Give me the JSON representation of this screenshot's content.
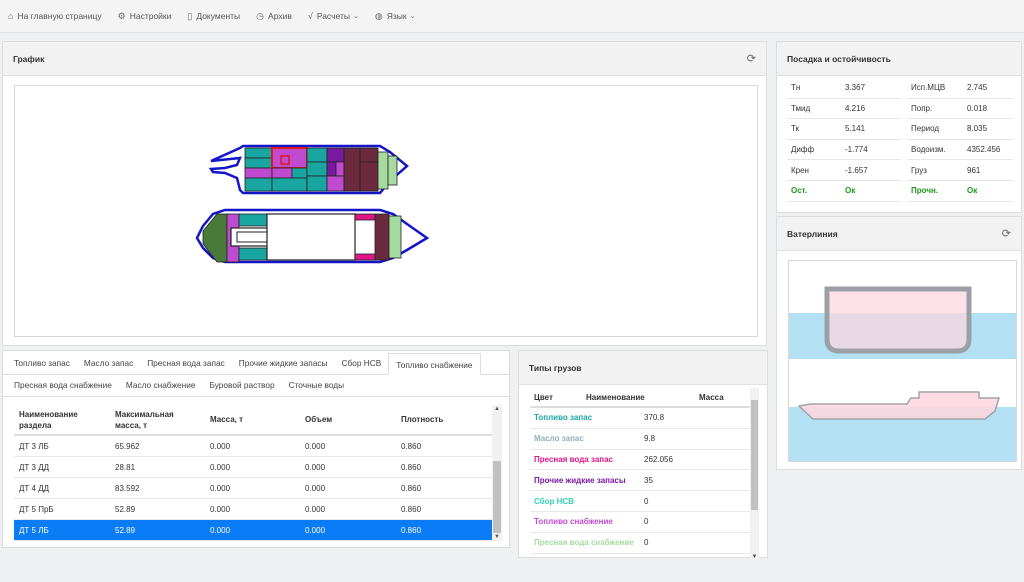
{
  "nav": {
    "home": "На главную страницу",
    "settings": "Настройки",
    "documents": "Документы",
    "archive": "Архив",
    "calculations": "Расчеты",
    "language": "Язык"
  },
  "graph": {
    "title": "График"
  },
  "tabs": {
    "row1": [
      "Топливо запас",
      "Масло запас",
      "Пресная вода запас",
      "Прочие жидкие запасы",
      "Сбор НСВ",
      "Топливо снабжение"
    ],
    "row2": [
      "Пресная вода снабжение",
      "Масло снабжение",
      "Буровой раствор",
      "Сточные воды"
    ],
    "active": "Топливо снабжение"
  },
  "capacity_table": {
    "headers": [
      "Наименование раздела",
      "Максимальная масса, т",
      "Масса, т",
      "Объем",
      "Плотность"
    ],
    "rows": [
      [
        "ДТ 3 ЛБ",
        "65.962",
        "0.000",
        "0.000",
        "0.860"
      ],
      [
        "ДТ 3 ДД",
        "28.81",
        "0.000",
        "0.000",
        "0.860"
      ],
      [
        "ДТ 4 ДД",
        "83.592",
        "0.000",
        "0.000",
        "0.860"
      ],
      [
        "ДТ 5 ПрБ",
        "52.89",
        "0.000",
        "0.000",
        "0.860"
      ],
      [
        "ДТ 5 ЛБ",
        "52.89",
        "0.000",
        "0.000",
        "0.860"
      ]
    ]
  },
  "cargo": {
    "title": "Типы грузов",
    "headers": [
      "Цвет",
      "Наименование",
      "Масса"
    ],
    "rows": [
      {
        "name": "Топливо запас",
        "mass": "370.8",
        "color": "#1aa6a0"
      },
      {
        "name": "Масло запас",
        "mass": "9.8",
        "color": "#8fb0b6"
      },
      {
        "name": "Пресная вода запас",
        "mass": "262.056",
        "color": "#e0158a"
      },
      {
        "name": "Прочие жидкие запасы",
        "mass": "35",
        "color": "#7a1aa0"
      },
      {
        "name": "Сбор НСВ",
        "mass": "0",
        "color": "#2fd6b4"
      },
      {
        "name": "Топливо снабжение",
        "mass": "0",
        "color": "#c04ad0"
      },
      {
        "name": "Пресная вода снабжение",
        "mass": "0",
        "color": "#a6dba0"
      }
    ]
  },
  "stability": {
    "title": "Посадка и остойчивость",
    "rows": [
      [
        "Тн",
        "3.367",
        "Исп.МЦВ",
        "2.745"
      ],
      [
        "Тмид",
        "4.216",
        "Попр.",
        "0.018"
      ],
      [
        "Тк",
        "5.141",
        "Период",
        "8.035"
      ],
      [
        "Дифф",
        "-1.774",
        "Водоизм.",
        "4352.456"
      ],
      [
        "Крен",
        "-1.657",
        "Груз",
        "961"
      ],
      [
        "Ост.",
        "Ок",
        "Прочн.",
        "Ок"
      ]
    ]
  },
  "waterline": {
    "title": "Ватерлиния"
  }
}
